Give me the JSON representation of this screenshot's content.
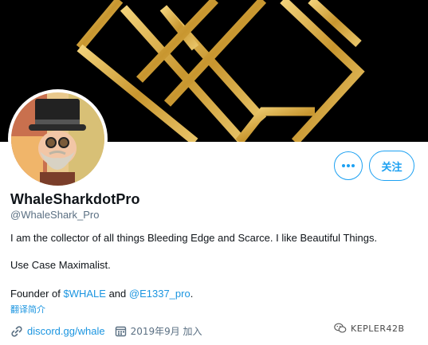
{
  "profile": {
    "display_name": "WhaleSharkdotPro",
    "handle": "@WhaleShark_Pro",
    "bio_line1": "I am the collector of all things Bleeding Edge and Scarce. I like Beautiful Things.",
    "bio_line2": "Use Case Maximalist.",
    "bio_founder_prefix": "Founder of ",
    "bio_link1": "$WHALE",
    "bio_and": " and ",
    "bio_link2": "@E1337_pro",
    "bio_end": ".",
    "translate_label": "翻译简介",
    "website": "discord.gg/whale",
    "joined": "2019年9月 加入"
  },
  "actions": {
    "follow_label": "关注",
    "more_icon": "more-dots-icon"
  },
  "watermark": {
    "text": "KEPLER42B"
  },
  "colors": {
    "accent": "#1da1f2",
    "link": "#1b95e0",
    "secondary_text": "#5b7083",
    "banner_bg": "#000000",
    "banner_gold": "#d4a94a"
  }
}
